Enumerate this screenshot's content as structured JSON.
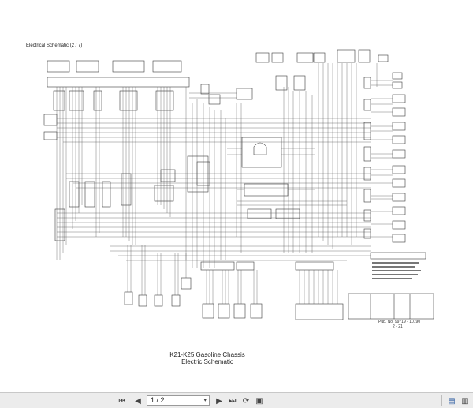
{
  "document": {
    "header": "Electrical Schematic (2 / 7)",
    "caption_line1": "K21-K25 Gasoline Chassis",
    "caption_line2": "Electric Schematic",
    "pub_no": "Pub. No. 99719 - 10190",
    "page_no": "2 - 21"
  },
  "toolbar": {
    "page_indicator": "1 / 2",
    "dropdown_caret": "▾",
    "first_page_icon": "⏮",
    "prev_page_icon": "◀",
    "next_page_icon": "▶",
    "last_page_icon": "⏭",
    "rotate_icon": "⟳",
    "fit_icon": "▣",
    "single_page_icon": "▤",
    "two_page_icon": "▥"
  }
}
